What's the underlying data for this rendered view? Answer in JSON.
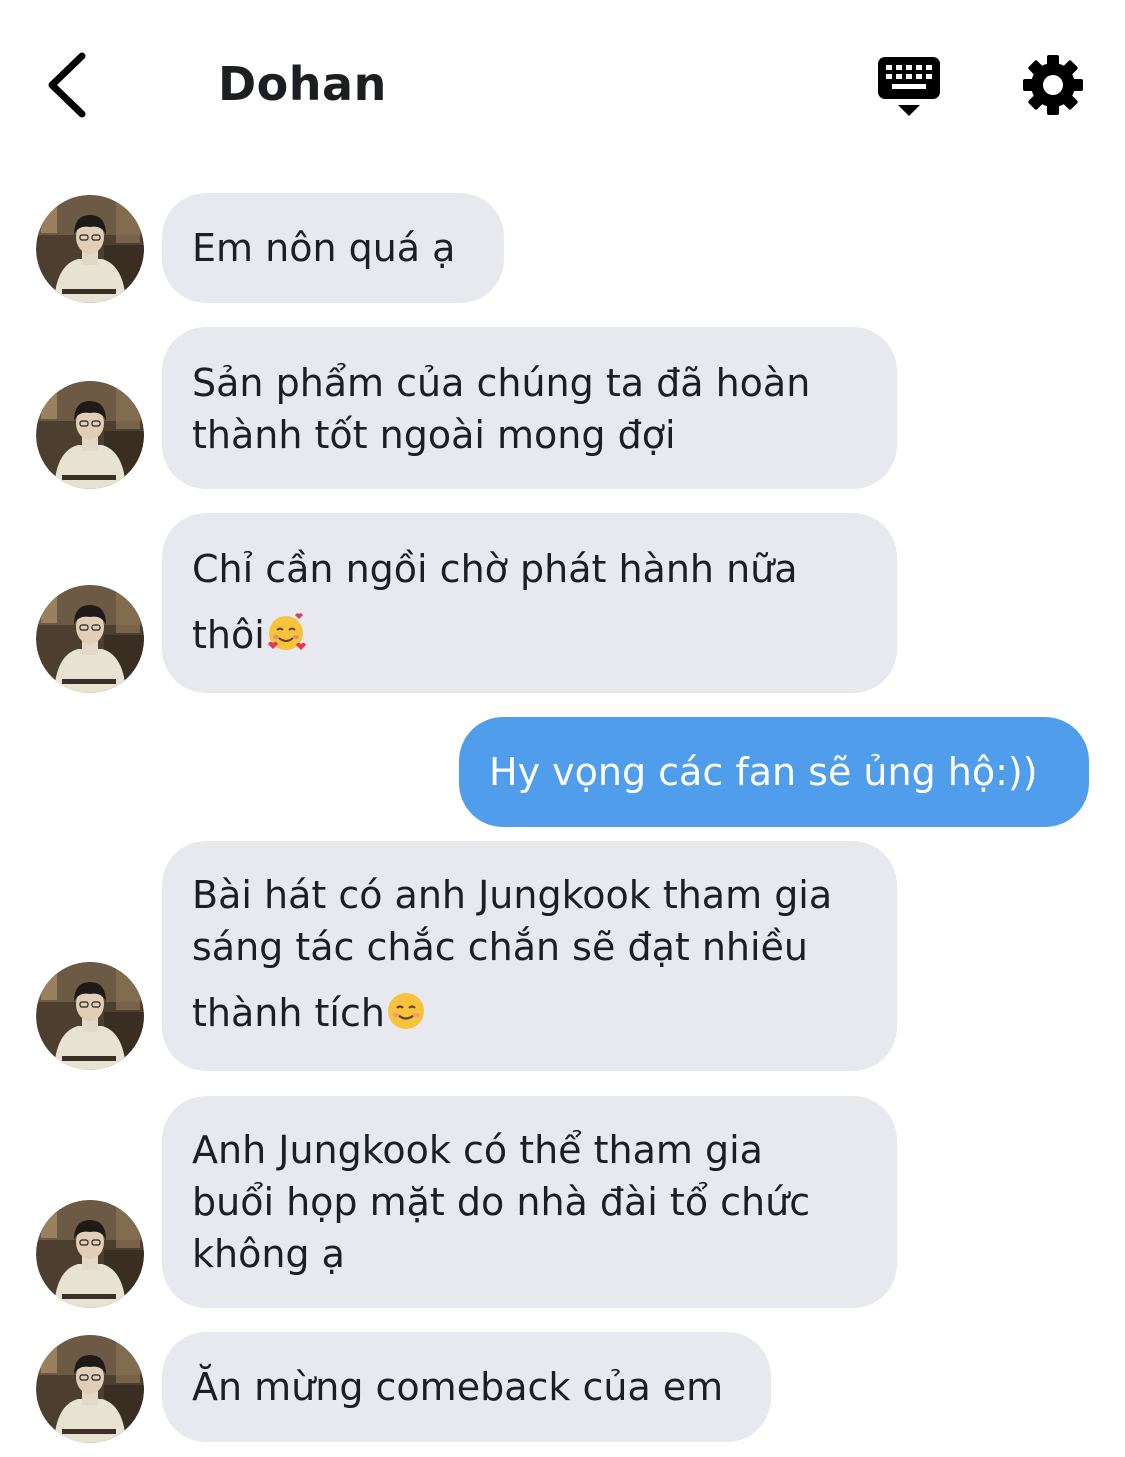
{
  "header": {
    "title": "Dohan"
  },
  "messages": [
    {
      "sender": "contact",
      "lines": [
        "Em nôn quá ạ"
      ]
    },
    {
      "sender": "contact",
      "lines": [
        "Sản phẩm của chúng ta đã hoàn",
        "thành tốt ngoài mong đợi"
      ]
    },
    {
      "sender": "contact",
      "lines": [
        "Chỉ cần ngồi chờ phát hành nữa",
        "thôi"
      ],
      "emoji": "smiling-face-with-hearts"
    },
    {
      "sender": "me",
      "lines": [
        "Hy vọng các fan sẽ ủng hộ:))"
      ]
    },
    {
      "sender": "contact",
      "lines": [
        "Bài hát có anh Jungkook tham gia",
        "sáng tác chắc chắn sẽ đạt nhiều",
        "thành tích"
      ],
      "emoji": "smiling-face"
    },
    {
      "sender": "contact",
      "lines": [
        "Anh Jungkook có thể tham gia",
        "buổi họp mặt do nhà đài tổ chức",
        "không ạ"
      ]
    },
    {
      "sender": "contact",
      "lines": [
        "Ăn mừng comeback của em"
      ]
    }
  ],
  "colors": {
    "incoming_bubble": "#e7e9ef",
    "outgoing_bubble": "#4f9deb",
    "outgoing_text": "#ffffff"
  },
  "icons": {
    "back": "chevron-left-icon",
    "keyboard": "keyboard-icon",
    "settings": "gear-icon"
  }
}
